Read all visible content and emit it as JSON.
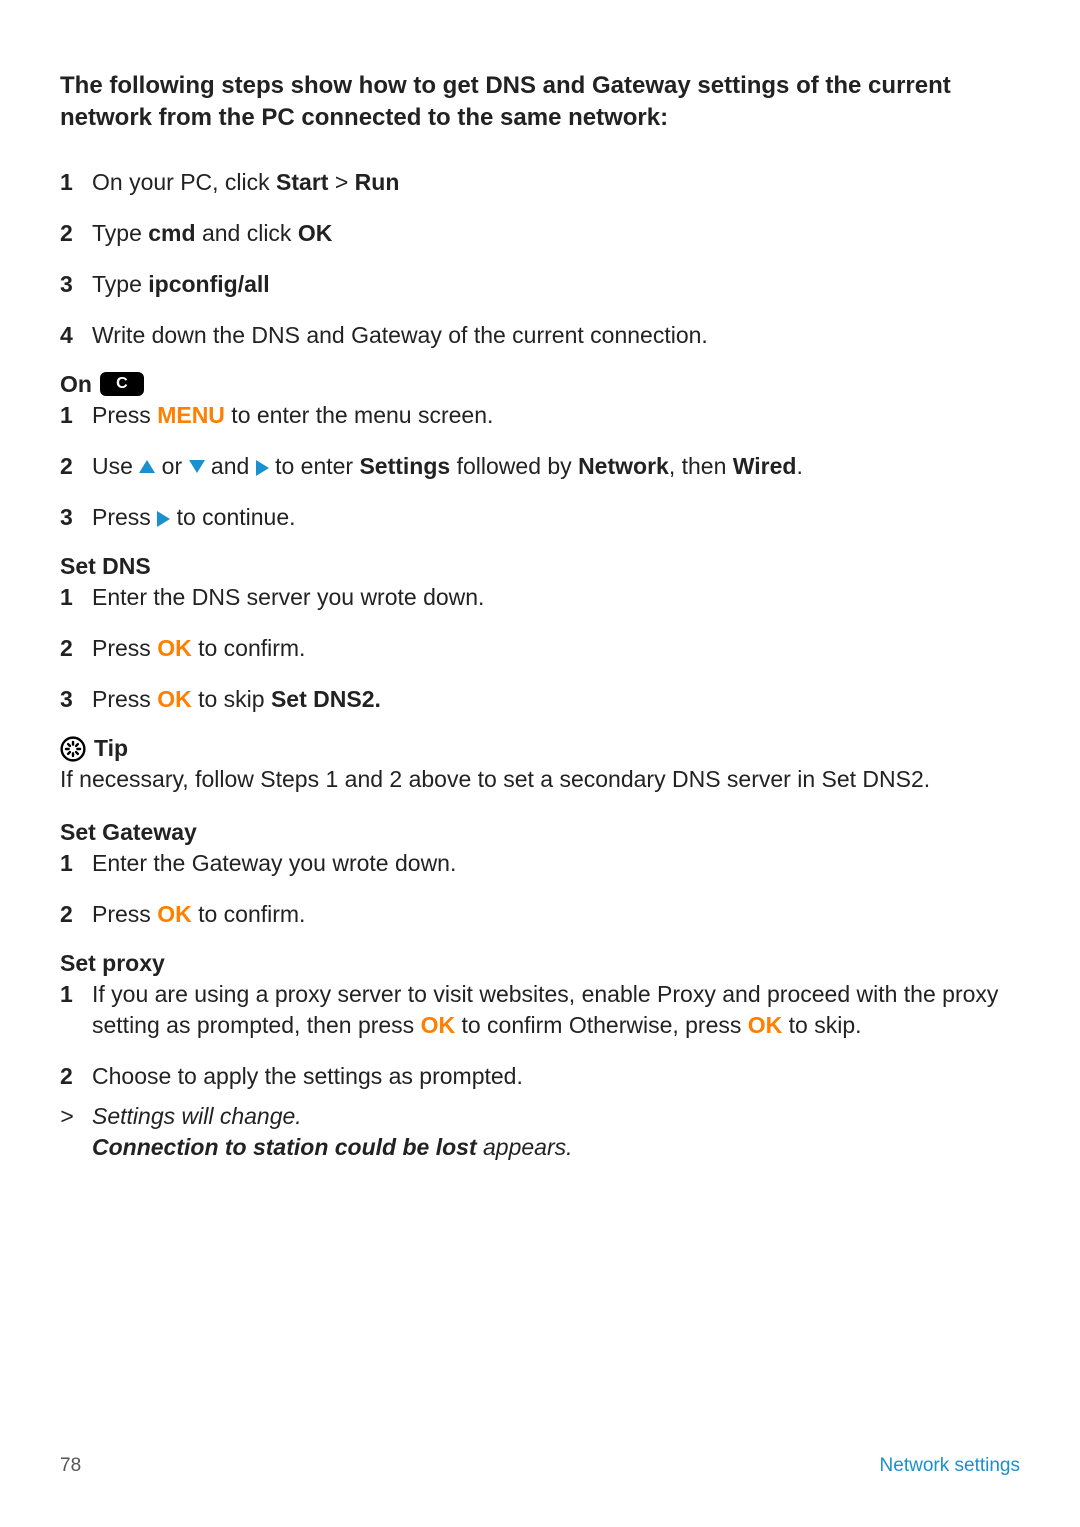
{
  "intro_text": "The following steps show how to get DNS and Gateway settings of the current network from the PC connected to the same network:",
  "pc_steps": {
    "s1_pre": "On your PC, click ",
    "s1_b1": "Start",
    "s1_mid": " > ",
    "s1_b2": "Run",
    "s2_pre": "Type ",
    "s2_b1": "cmd",
    "s2_post": " and click ",
    "s2_b2": "OK",
    "s3_pre": "Type ",
    "s3_b1": "ipconfig/all",
    "s4": "Write down the DNS and Gateway of the current connection."
  },
  "on_label": "On",
  "on_badge": "C",
  "device_steps": {
    "s1_pre": "Press ",
    "s1_menu": "MENU",
    "s1_post": " to enter the menu screen.",
    "s2_pre": "Use ",
    "s2_or": " or ",
    "s2_and": " and ",
    "s2_mid": " to enter ",
    "s2_b1": "Settings",
    "s2_mid2": " followed by ",
    "s2_b2": "Network",
    "s2_mid3": ", then ",
    "s2_b3": "Wired",
    "s2_end": ".",
    "s3_pre": "Press ",
    "s3_post": " to continue."
  },
  "set_dns_heading": "Set DNS",
  "dns_steps": {
    "s1": "Enter the DNS server you wrote down.",
    "s2_pre": "Press ",
    "s2_ok": "OK",
    "s2_post": " to confirm.",
    "s3_pre": "Press ",
    "s3_ok": "OK",
    "s3_mid": " to skip ",
    "s3_b1": "Set DNS2."
  },
  "tip_label": "Tip",
  "tip_body": "If necessary, follow Steps 1 and 2 above to set a secondary DNS server in Set DNS2.",
  "set_gateway_heading": "Set Gateway",
  "gw_steps": {
    "s1": "Enter the Gateway you wrote down.",
    "s2_pre": "Press ",
    "s2_ok": "OK",
    "s2_post": " to confirm."
  },
  "set_proxy_heading": "Set proxy",
  "proxy_steps": {
    "s1_pre": "If you are using a proxy server to visit websites, enable Proxy and proceed with the proxy setting as prompted, then press ",
    "s1_ok1": "OK",
    "s1_mid": " to confirm Otherwise, press ",
    "s1_ok2": "OK",
    "s1_post": " to skip.",
    "s2": "Choose to apply the settings as prompted."
  },
  "result": {
    "gt": ">",
    "line1": "Settings will change.",
    "line2_b": "Connection to station could be lost",
    "line2_post": " appears."
  },
  "footer": {
    "page_no": "78",
    "section": "Network settings"
  }
}
